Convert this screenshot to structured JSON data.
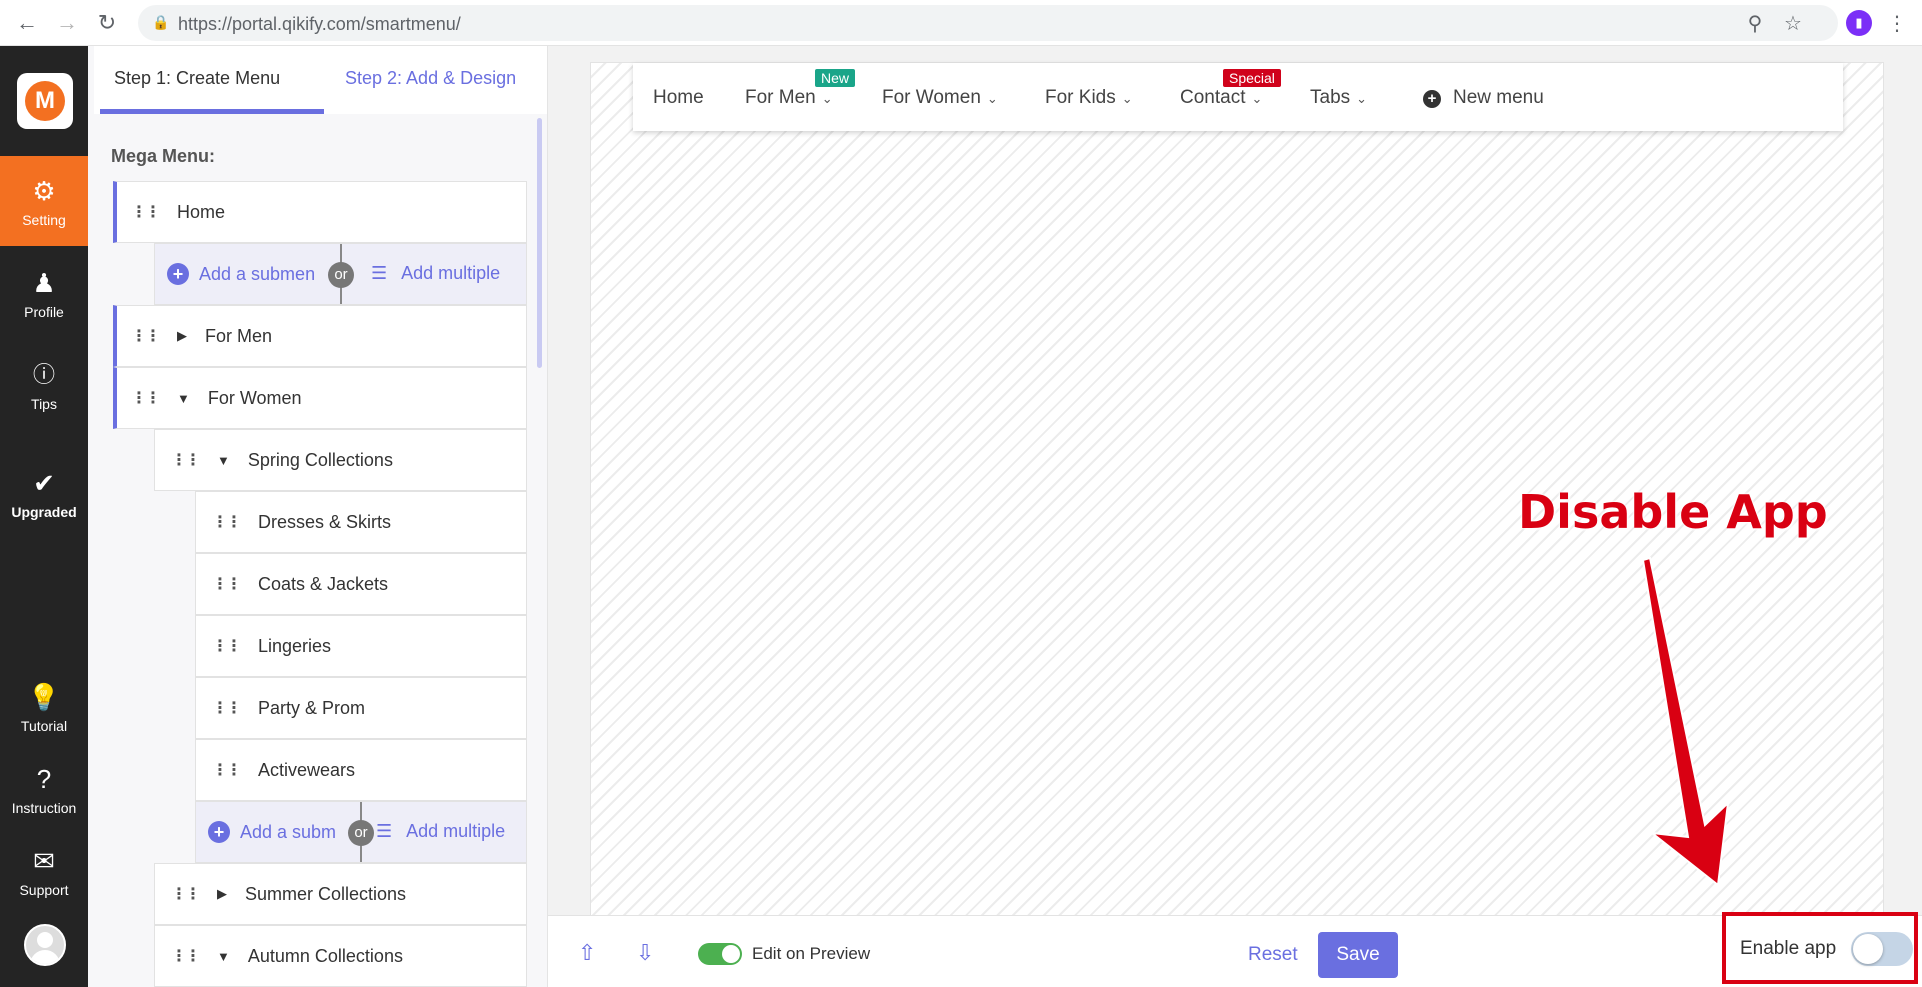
{
  "browser": {
    "url": "https://portal.qikify.com/smartmenu/"
  },
  "sidebar": {
    "logo_letter": "M",
    "items": [
      {
        "label": "Setting",
        "icon": "gear-icon",
        "active": true
      },
      {
        "label": "Profile",
        "icon": "person-icon"
      },
      {
        "label": "Tips",
        "icon": "info-icon"
      },
      {
        "label": "Upgraded",
        "icon": "check-icon"
      },
      {
        "label": "Tutorial",
        "icon": "lightbulb-icon"
      },
      {
        "label": "Instruction",
        "icon": "question-icon"
      },
      {
        "label": "Support",
        "icon": "envelope-icon"
      }
    ]
  },
  "panel": {
    "tab1": "Step 1: Create Menu",
    "tab2": "Step 2: Add & Design",
    "mega_label": "Mega Menu:",
    "or": "or",
    "add_submenu_1": "Add a submen",
    "add_multiple_1": "Add multiple",
    "add_submenu_2": "Add a subm",
    "add_multiple_2": "Add multiple",
    "tree": {
      "home": "Home",
      "for_men": "For Men",
      "for_women": "For Women",
      "spring": "Spring Collections",
      "dresses": "Dresses & Skirts",
      "coats": "Coats & Jackets",
      "lingeries": "Lingeries",
      "party": "Party & Prom",
      "activewears": "Activewears",
      "summer": "Summer Collections",
      "autumn": "Autumn Collections"
    }
  },
  "preview_menu": {
    "home": "Home",
    "for_men": "For Men",
    "for_men_badge": "New",
    "for_men_badge_color": "#1aa589",
    "for_women": "For Women",
    "for_kids": "For Kids",
    "contact": "Contact",
    "contact_badge": "Special",
    "contact_badge_color": "#d0021b",
    "tabs": "Tabs",
    "new_menu": "New menu"
  },
  "annotation": {
    "text": "Disable App",
    "color": "#d90012"
  },
  "footer": {
    "edit_on_preview": "Edit on Preview",
    "edit_on_preview_enabled": true,
    "reset": "Reset",
    "save": "Save",
    "enable_app": "Enable app",
    "enable_app_enabled": false
  }
}
